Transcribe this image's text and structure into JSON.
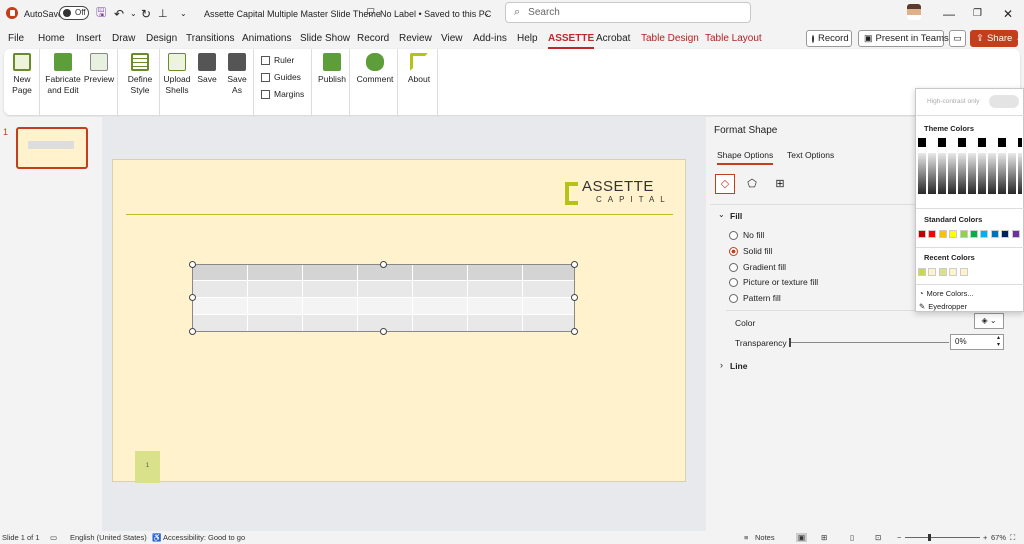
{
  "titlebar": {
    "autosave_label": "AutoSave",
    "autosave_state": "Off",
    "doc_title": "Assette Capital Multiple Master Slide Theme",
    "label_status": "No Label • Saved to this PC",
    "search_placeholder": "Search"
  },
  "menu": {
    "tabs": [
      "File",
      "Home",
      "Insert",
      "Draw",
      "Design",
      "Transitions",
      "Animations",
      "Slide Show",
      "Record",
      "Review",
      "View",
      "Add-ins",
      "Help",
      "ASSETTE",
      "Acrobat",
      "Table Design",
      "Table Layout"
    ],
    "record_label": "Record",
    "present_label": "Present in Teams",
    "share_label": "Share"
  },
  "ribbon": {
    "new_page": "New Page",
    "fabricate": "Fabricate and Edit",
    "preview": "Preview",
    "define_style": "Define Style",
    "upload_shells": "Upload Shells",
    "save": "Save",
    "save_as": "Save As",
    "ruler": "Ruler",
    "guides": "Guides",
    "margins": "Margins",
    "publish": "Publish",
    "comment": "Comment",
    "about": "About"
  },
  "slides": {
    "number": "1",
    "page_number": "1",
    "logo_top": "ASSETTE",
    "logo_bottom": "CAPITAL"
  },
  "format_pane": {
    "title": "Format Shape",
    "tab_shape": "Shape Options",
    "tab_text": "Text Options",
    "fill_heading": "Fill",
    "fill_options": [
      "No fill",
      "Solid fill",
      "Gradient fill",
      "Picture or texture fill",
      "Pattern fill"
    ],
    "color_label": "Color",
    "transparency_label": "Transparency",
    "transparency_value": "0%",
    "line_heading": "Line"
  },
  "color_popup": {
    "high_contrast": "High-contrast only",
    "theme_heading": "Theme Colors",
    "standard_heading": "Standard Colors",
    "recent_heading": "Recent Colors",
    "more_colors": "More Colors...",
    "eyedropper": "Eyedropper",
    "standard_colors": [
      "#c00000",
      "#ff0000",
      "#ffc000",
      "#ffff00",
      "#92d050",
      "#00b050",
      "#00b0f0",
      "#0070c0",
      "#002060",
      "#7030a0"
    ],
    "recent_colors": [
      "#c9d94a",
      "#fff2cc",
      "#d9e28a",
      "#fff2cc",
      "#fff2cc"
    ]
  },
  "status": {
    "slide_info": "Slide 1 of 1",
    "language": "English (United States)",
    "accessibility": "Accessibility: Good to go",
    "notes": "Notes",
    "zoom": "67%"
  },
  "colors": {
    "accent": "#c43e1c",
    "slide_bg": "#fff2cc",
    "logo_green": "#b5c21a"
  }
}
